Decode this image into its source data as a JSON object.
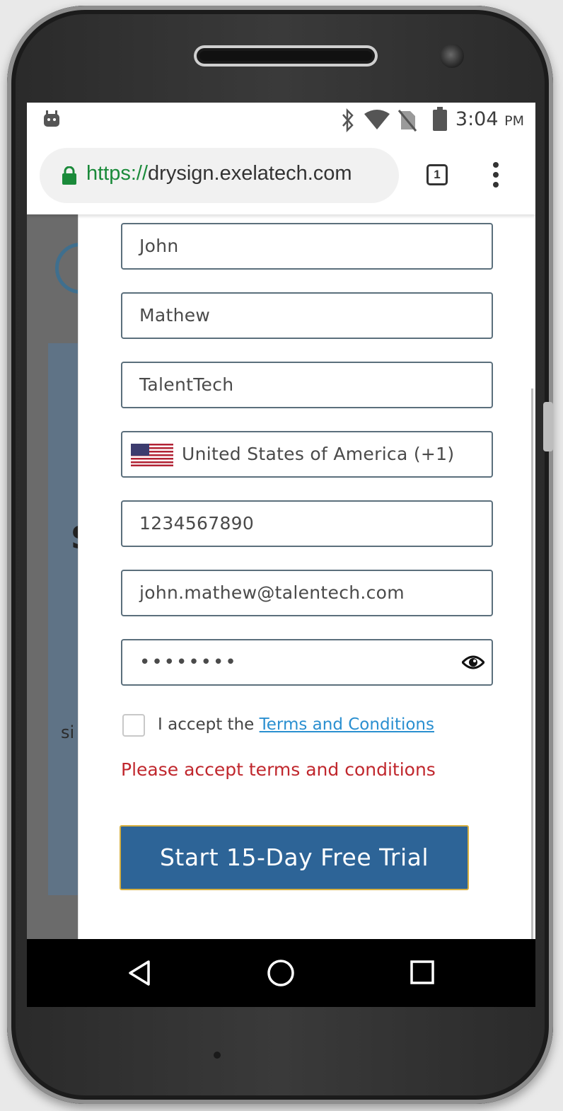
{
  "status_bar": {
    "time": "3:04",
    "ampm": "PM"
  },
  "browser": {
    "url_scheme": "https://",
    "url_host": "drysign.exelatech.com",
    "tab_count": "1"
  },
  "form": {
    "first_name": "John",
    "last_name": "Mathew",
    "company": "TalentTech",
    "country": "United States of America (+1)",
    "phone": "1234567890",
    "email": "john.mathew@talentech.com",
    "password_masked": "••••••••",
    "accept_prefix": "I accept the ",
    "terms_link": "Terms and Conditions",
    "error_message": "Please accept terms and conditions",
    "submit_label": "Start 15-Day Free Trial"
  },
  "background_page": {
    "heading_fragment": "S",
    "text_fragment": "si"
  },
  "colors": {
    "button_bg": "#2d6497",
    "button_border": "#d7b041",
    "error": "#c0272d",
    "link": "#2a8fd0",
    "lock_green": "#1a8a3a"
  }
}
